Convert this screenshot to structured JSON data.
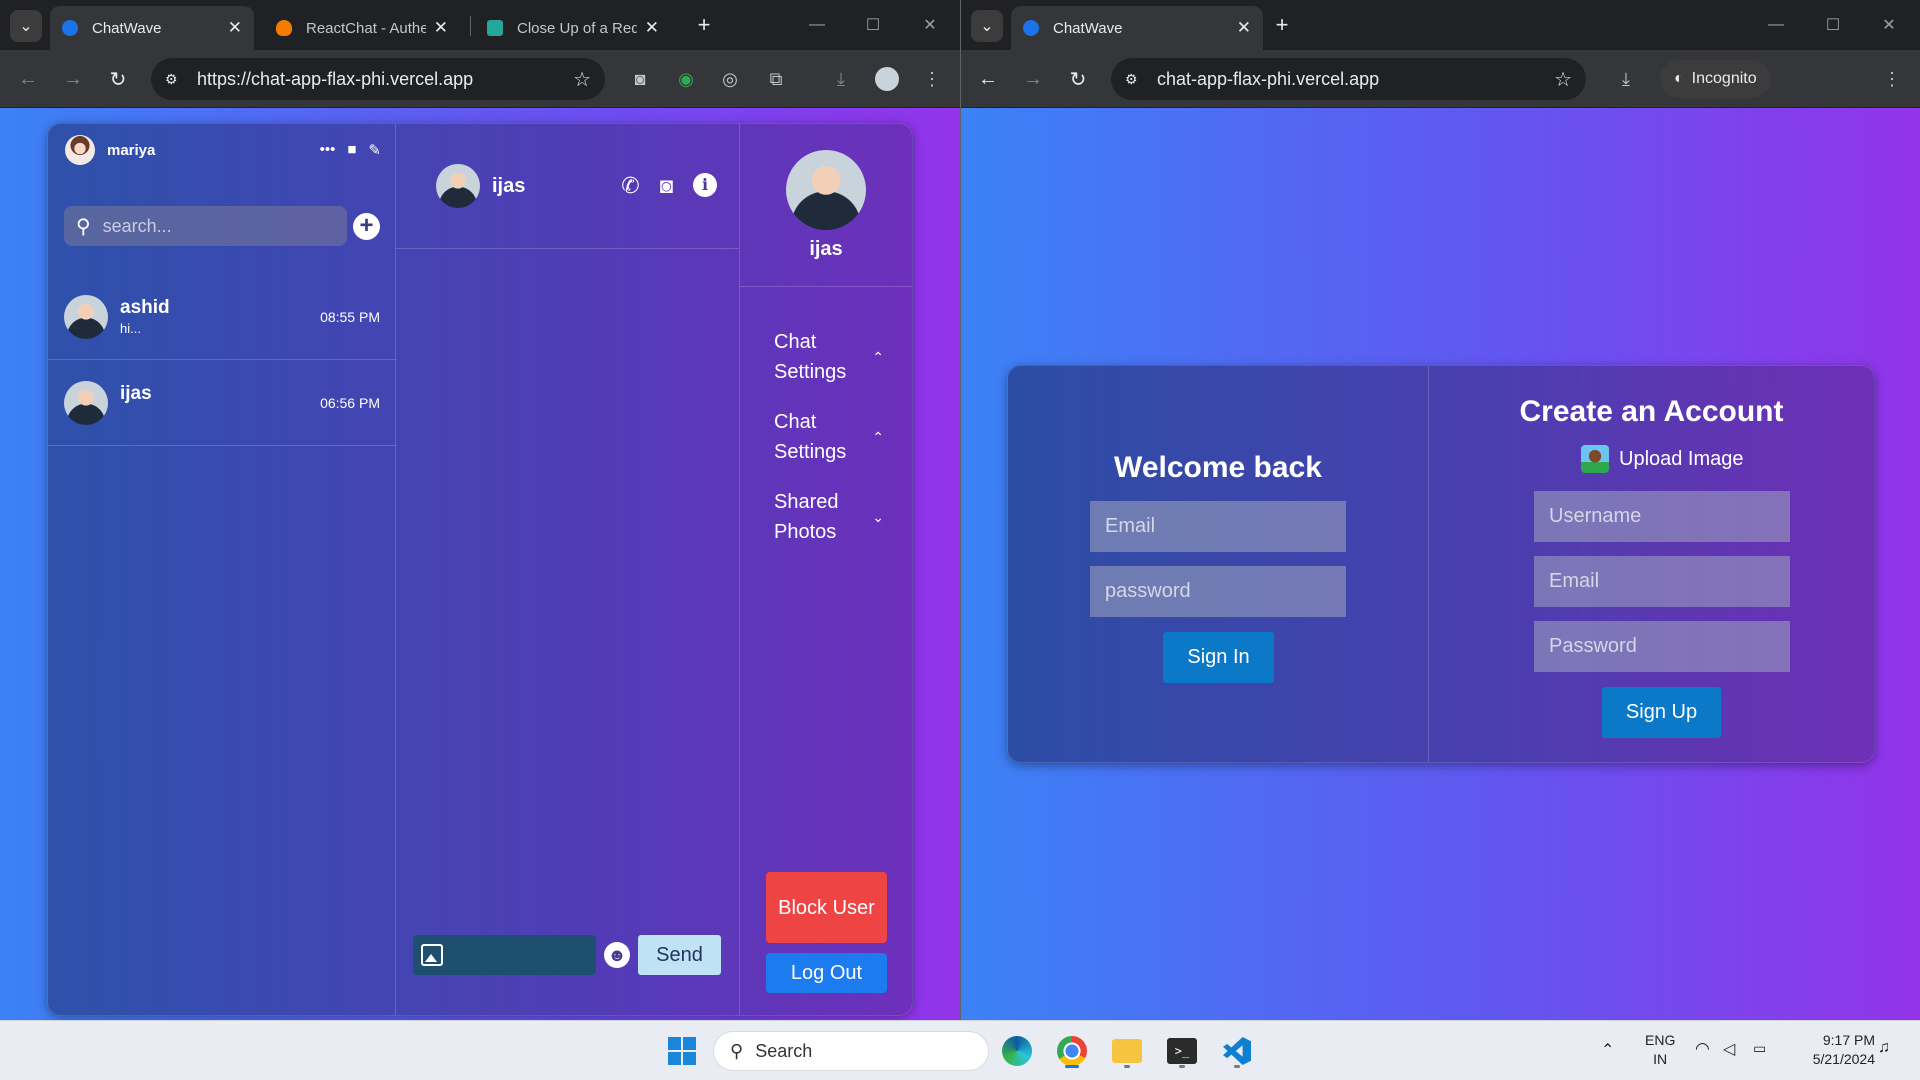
{
  "left_window": {
    "tabs": [
      {
        "title": "ChatWave",
        "active": true,
        "favicon_color": "#1a73e8"
      },
      {
        "title": "ReactChat - Authe",
        "active": false,
        "favicon_color": "#f57c00"
      },
      {
        "title": "Close Up of a Red",
        "active": false,
        "favicon_color": "#26a69a"
      }
    ],
    "url": "https://chat-app-flax-phi.vercel.app"
  },
  "right_window": {
    "tabs": [
      {
        "title": "ChatWave",
        "active": true,
        "favicon_color": "#1a73e8"
      }
    ],
    "url": "chat-app-flax-phi.vercel.app",
    "incognito_label": "Incognito"
  },
  "chat_app": {
    "current_user": "mariya",
    "search_placeholder": "search...",
    "chats": [
      {
        "name": "ashid",
        "last_message": "hi...",
        "time": "08:55 PM"
      },
      {
        "name": "ijas",
        "last_message": "",
        "time": "06:56 PM"
      }
    ],
    "active_chat": {
      "name": "ijas"
    },
    "composer": {
      "send_label": "Send",
      "emoji": "☻"
    },
    "detail": {
      "name": "ijas",
      "options": [
        {
          "label": "Chat Settings",
          "state": "expanded"
        },
        {
          "label": "Chat Settings",
          "state": "expanded"
        },
        {
          "label": "Shared Photos",
          "state": "collapsed"
        }
      ],
      "block_label": "Block User",
      "logout_label": "Log Out"
    }
  },
  "login_app": {
    "welcome_title": "Welcome back",
    "email_placeholder": "Email",
    "password_placeholder": "password",
    "sign_in_label": "Sign In",
    "create_title": "Create an Account",
    "upload_label": "Upload Image",
    "username_placeholder": "Username",
    "signup_email_placeholder": "Email",
    "signup_password_placeholder": "Password",
    "sign_up_label": "Sign Up"
  },
  "taskbar": {
    "search_label": "Search",
    "language": "ENG",
    "region": "IN",
    "time": "9:17 PM",
    "date": "5/21/2024"
  },
  "colors": {
    "gradient_start": "#3b82f6",
    "gradient_end": "#9333ea",
    "block_button": "#ef4444",
    "logout_button": "#1d7bf0",
    "primary_button": "#0b78c8",
    "send_button": "#bfe3f5"
  }
}
